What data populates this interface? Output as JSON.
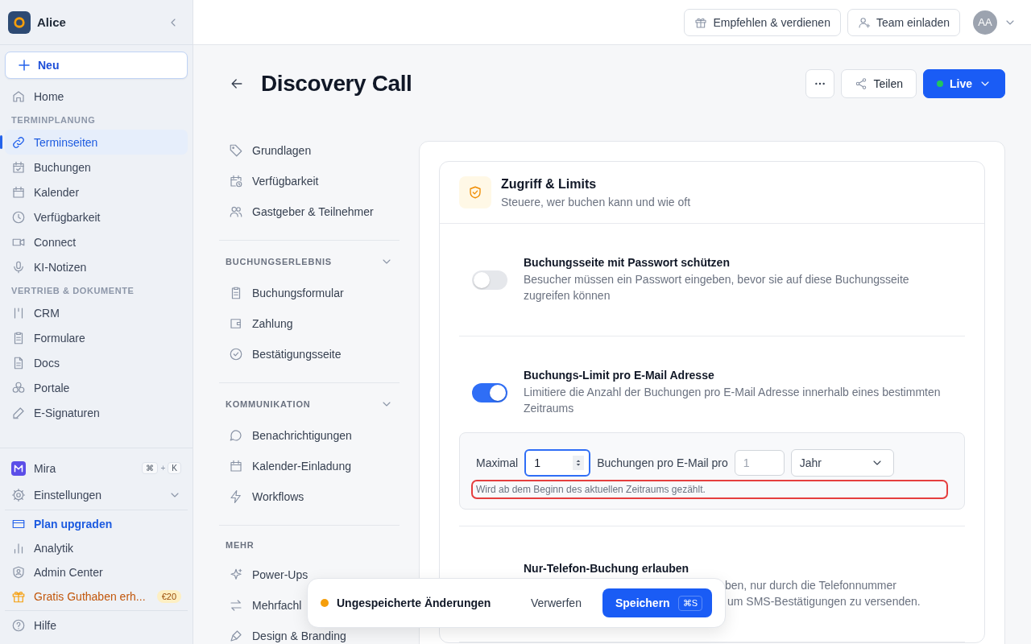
{
  "sidebar": {
    "workspace": "Alice",
    "new_button": "Neu",
    "nav": [
      {
        "kind": "item",
        "label": "Home",
        "selected": false
      },
      {
        "kind": "section",
        "label": "TERMINPLANUNG"
      },
      {
        "kind": "item",
        "label": "Terminseiten",
        "selected": true
      },
      {
        "kind": "item",
        "label": "Buchungen",
        "selected": false
      },
      {
        "kind": "item",
        "label": "Kalender",
        "selected": false
      },
      {
        "kind": "item",
        "label": "Verfügbarkeit",
        "selected": false
      },
      {
        "kind": "item",
        "label": "Connect",
        "selected": false
      },
      {
        "kind": "item",
        "label": "KI-Notizen",
        "selected": false
      },
      {
        "kind": "section",
        "label": "VERTRIEB & DOKUMENTE"
      },
      {
        "kind": "item",
        "label": "CRM",
        "selected": false
      },
      {
        "kind": "item",
        "label": "Formulare",
        "selected": false
      },
      {
        "kind": "item",
        "label": "Docs",
        "selected": false
      },
      {
        "kind": "item",
        "label": "Portale",
        "selected": false
      },
      {
        "kind": "item",
        "label": "E-Signaturen",
        "selected": false
      }
    ],
    "footer_groups": [
      [
        {
          "kind": "app",
          "label": "Mira",
          "shortcut": [
            "⌘",
            "+",
            "K"
          ]
        },
        {
          "kind": "expandable",
          "label": "Einstellungen",
          "expanded": false
        }
      ],
      [
        {
          "kind": "accent",
          "label": "Plan upgraden"
        },
        {
          "kind": "plain",
          "label": "Analytik"
        },
        {
          "kind": "plain",
          "label": "Admin Center"
        },
        {
          "kind": "promo",
          "label": "Gratis Guthaben erh...",
          "badge": "€20"
        }
      ],
      [
        {
          "kind": "plain",
          "label": "Hilfe"
        }
      ]
    ]
  },
  "topbar": {
    "buttons": [
      "Empfehlen & verdienen",
      "Team einladen"
    ],
    "avatar": "AA"
  },
  "header": {
    "title": "Discovery Call",
    "share": "Teilen",
    "status": {
      "label": "Live",
      "color": "#22c55e"
    }
  },
  "subnav": [
    {
      "items": [
        "Grundlagen",
        "Verfügbarkeit",
        "Gastgeber & Teilnehmer"
      ]
    },
    {
      "title": "BUCHUNGSERLEBNIS",
      "expanded": true,
      "items": [
        "Buchungsformular",
        "Zahlung",
        "Bestätigungsseite"
      ]
    },
    {
      "title": "KOMMUNIKATION",
      "expanded": true,
      "items": [
        "Benachrichtigungen",
        "Kalender-Einladung",
        "Workflows"
      ]
    },
    {
      "title": "MEHR",
      "items": [
        "Power-Ups",
        "Mehrfachl",
        "Design & Branding"
      ]
    }
  ],
  "section": {
    "title": "Zugriff & Limits",
    "subtitle": "Steuere, wer buchen kann und wie oft",
    "settings": [
      {
        "title": "Buchungsseite mit Passwort schützen",
        "description": "Besucher müssen ein Passwort eingeben, bevor sie auf diese Buchungsseite zugreifen können",
        "on": false
      },
      {
        "title": "Buchungs-Limit pro E-Mail Adresse",
        "description": "Limitiere die Anzahl der Buchungen pro E-Mail Adresse innerhalb eines bestimmten Zeitraums",
        "on": true,
        "limit": {
          "label_before": "Maximal",
          "max": "1",
          "max_focused": true,
          "label_middle": "Buchungen pro E-Mail pro",
          "count_placeholder": "1",
          "period": "Jahr",
          "hint": "Wird ab dem Beginn des aktuellen Zeitraums gezählt.",
          "hint_highlighted": true
        }
      },
      {
        "title": "Nur-Telefon-Buchung erlauben",
        "description_lines": [
          "ben, nur durch die Telefonnummer",
          "um SMS-Bestätigungen zu versenden."
        ]
      }
    ]
  },
  "save_bar": {
    "message": "Ungespeicherte Änderungen",
    "discard": "Verwerfen",
    "save": "Speichern",
    "shortcut": "⌘S"
  }
}
